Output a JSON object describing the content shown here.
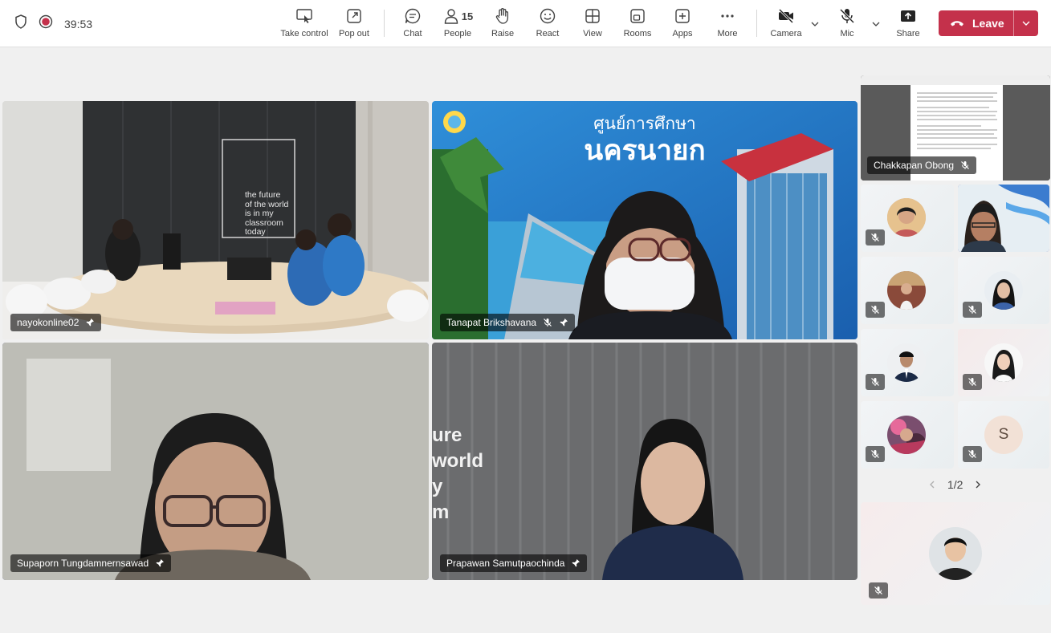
{
  "meeting": {
    "timer": "39:53"
  },
  "toolbar": {
    "take_control": "Take control",
    "pop_out": "Pop out",
    "chat": "Chat",
    "people": "People",
    "people_count": "15",
    "raise": "Raise",
    "react": "React",
    "view": "View",
    "rooms": "Rooms",
    "apps": "Apps",
    "more": "More",
    "camera": "Camera",
    "mic": "Mic",
    "share": "Share",
    "leave": "Leave"
  },
  "stage": {
    "tiles": [
      {
        "name": "nayokonline02",
        "pinned": true,
        "muted": false
      },
      {
        "name": "Tanapat Brikshavana",
        "pinned": true,
        "muted": true
      },
      {
        "name": "Supaporn Tungdamnernsawad",
        "pinned": true,
        "muted": false,
        "active_speaker": true
      },
      {
        "name": "Prapawan Samutpaochinda",
        "pinned": true,
        "muted": false
      }
    ],
    "slide_text": {
      "classroom_sign": [
        "the future",
        "of the world",
        "is in my",
        "classroom",
        "today"
      ],
      "thai_line1": "ศูนย์การศึกษา",
      "thai_line2": "นครนายก",
      "wall_text": [
        "ure",
        "world",
        "y",
        "m"
      ]
    }
  },
  "side_rail": {
    "share_tile_name": "Chakkapan Obong",
    "avatar_letter": "S",
    "pager": "1/2"
  },
  "colors": {
    "accent": "#6264a7",
    "leave": "#c4314b"
  }
}
